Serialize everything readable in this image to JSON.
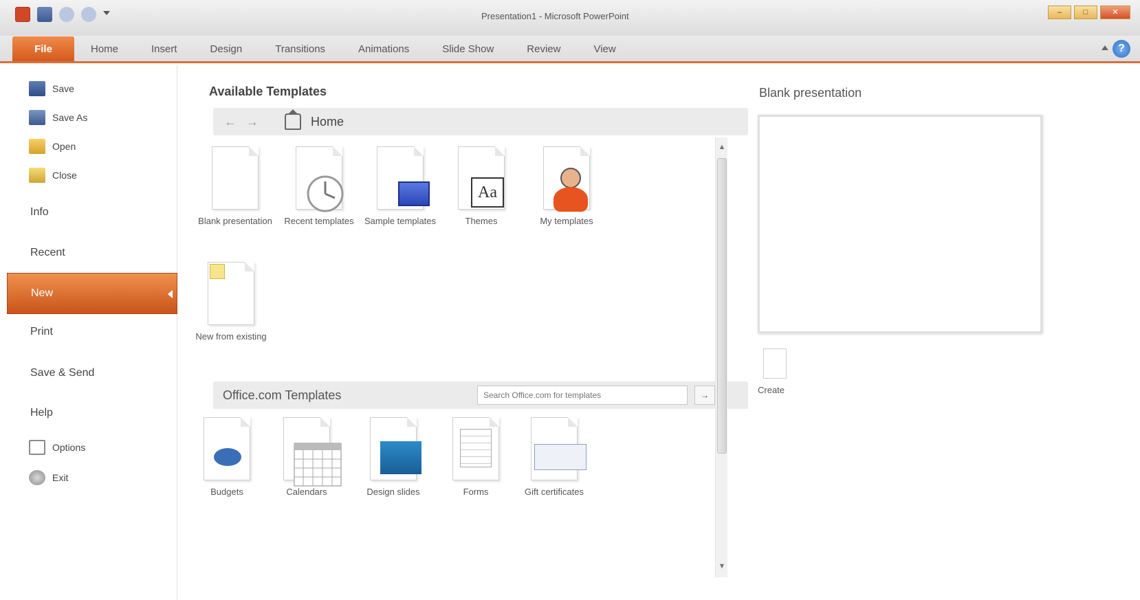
{
  "titlebar": {
    "title": "Presentation1 - Microsoft PowerPoint",
    "controls": [
      "–",
      "□",
      "✕"
    ]
  },
  "tabs": [
    "File",
    "Home",
    "Insert",
    "Design",
    "Transitions",
    "Animations",
    "Slide Show",
    "Review",
    "View"
  ],
  "nav": {
    "save": "Save",
    "save_as": "Save As",
    "open": "Open",
    "close": "Close",
    "info": "Info",
    "recent": "Recent",
    "new": "New",
    "print": "Print",
    "save_send": "Save & Send",
    "help": "Help",
    "options": "Options",
    "exit": "Exit"
  },
  "available": {
    "title": "Available Templates",
    "back": "←",
    "forward": "→",
    "home": "Home",
    "tiles": [
      "Blank presentation",
      "Recent templates",
      "Sample templates",
      "Themes",
      "My templates",
      "New from existing"
    ]
  },
  "office": {
    "title": "Office.com Templates",
    "search_placeholder": "Search Office.com for templates",
    "go": "→",
    "tiles": [
      "Budgets",
      "Calendars",
      "Design slides",
      "Forms",
      "Gift certificates"
    ]
  },
  "preview": {
    "title": "Blank presentation",
    "create": "Create"
  },
  "colors": {
    "accent": "#d8703a",
    "active": "#e27a3c"
  }
}
